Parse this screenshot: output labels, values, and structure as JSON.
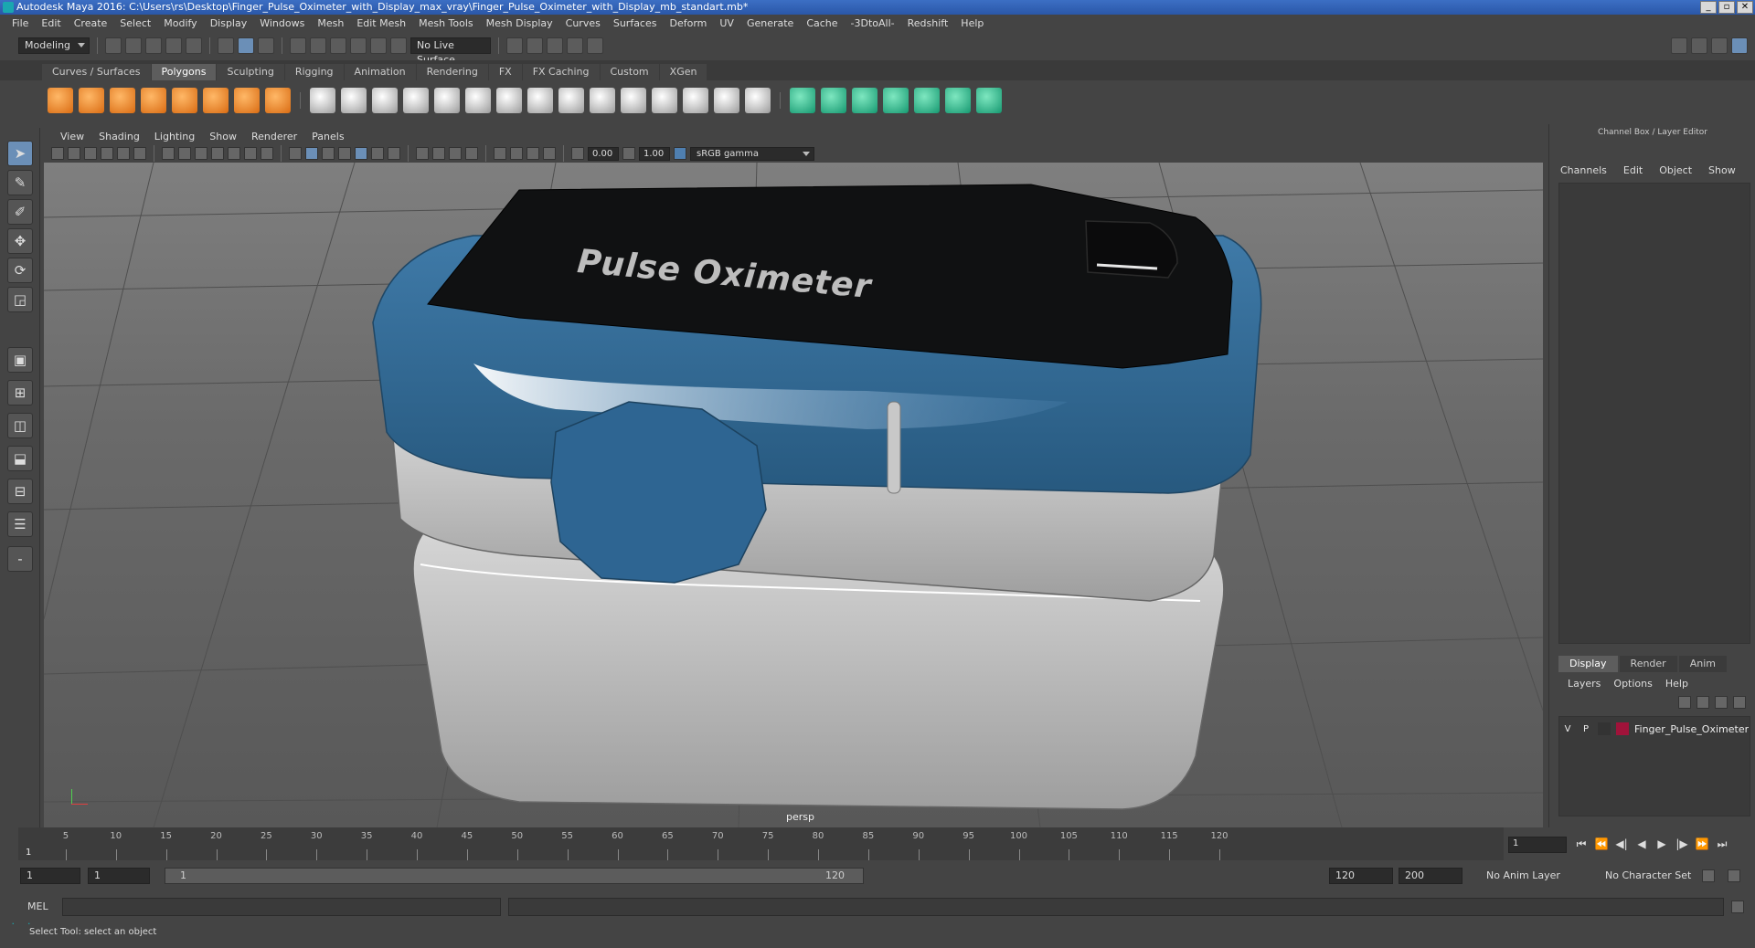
{
  "window": {
    "title": "Autodesk Maya 2016: C:\\Users\\rs\\Desktop\\Finger_Pulse_Oximeter_with_Display_max_vray\\Finger_Pulse_Oximeter_with_Display_mb_standart.mb*",
    "buttons": [
      "_",
      "▫",
      "✕"
    ]
  },
  "menubar": [
    "File",
    "Edit",
    "Create",
    "Select",
    "Modify",
    "Display",
    "Windows",
    "Mesh",
    "Edit Mesh",
    "Mesh Tools",
    "Mesh Display",
    "Curves",
    "Surfaces",
    "Deform",
    "UV",
    "Generate",
    "Cache",
    "-3DtoAll-",
    "Redshift",
    "Help"
  ],
  "toolbar": {
    "mode": "Modeling",
    "live_surface": "No Live Surface"
  },
  "shelf_tabs": [
    {
      "label": "Curves / Surfaces",
      "active": false
    },
    {
      "label": "Polygons",
      "active": true
    },
    {
      "label": "Sculpting",
      "active": false
    },
    {
      "label": "Rigging",
      "active": false
    },
    {
      "label": "Animation",
      "active": false
    },
    {
      "label": "Rendering",
      "active": false
    },
    {
      "label": "FX",
      "active": false
    },
    {
      "label": "FX Caching",
      "active": false
    },
    {
      "label": "Custom",
      "active": false
    },
    {
      "label": "XGen",
      "active": false
    }
  ],
  "viewport": {
    "menu": [
      "View",
      "Shading",
      "Lighting",
      "Show",
      "Renderer",
      "Panels"
    ],
    "exposure": "0.00",
    "gamma": "1.00",
    "color_space": "sRGB gamma",
    "camera": "persp",
    "model_text": "Pulse Oximeter",
    "colors": {
      "blue_shell": "#2f6792",
      "grey_body": "#c2c2c2",
      "screen": "#101112"
    }
  },
  "channel_box": {
    "title": "Channel Box / Layer Editor",
    "menu": [
      "Channels",
      "Edit",
      "Object",
      "Show"
    ],
    "layer_tabs": [
      {
        "label": "Display",
        "active": true
      },
      {
        "label": "Render",
        "active": false
      },
      {
        "label": "Anim",
        "active": false
      }
    ],
    "layer_menu": [
      "Layers",
      "Options",
      "Help"
    ],
    "layers": [
      {
        "v": "V",
        "p": "P",
        "name": "Finger_Pulse_Oximeter",
        "color": "#a0133a"
      }
    ]
  },
  "timeline": {
    "ticks": [
      "5",
      "10",
      "15",
      "20",
      "25",
      "30",
      "35",
      "40",
      "45",
      "50",
      "55",
      "60",
      "65",
      "70",
      "75",
      "80",
      "85",
      "90",
      "95",
      "100",
      "105",
      "110",
      "115",
      "120"
    ],
    "current_frame": "1",
    "current_frame_field": "1"
  },
  "range": {
    "start": "1",
    "playback_start": "1",
    "slider_start": "1",
    "slider_end": "120",
    "playback_end": "120",
    "end": "200",
    "anim_layer": "No Anim Layer",
    "character_set": "No Character Set"
  },
  "command_line": {
    "label": "MEL"
  },
  "help_line": "Select Tool: select an object"
}
